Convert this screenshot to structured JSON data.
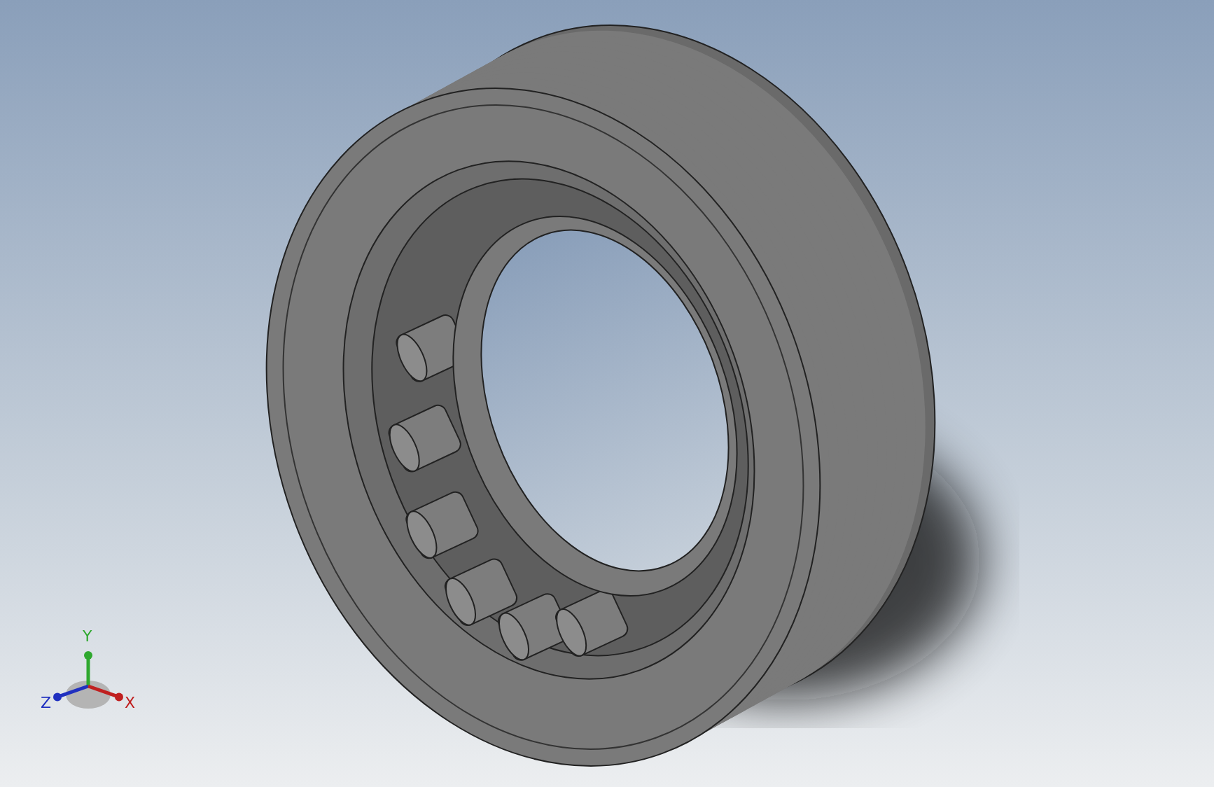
{
  "viewport": {
    "triad": {
      "axes": [
        {
          "kind": "up",
          "label": "Y",
          "color": "#2fa82f"
        },
        {
          "kind": "left",
          "label": "Z",
          "color": "#2030c0"
        },
        {
          "kind": "right",
          "label": "X",
          "color": "#c02020"
        }
      ]
    }
  }
}
